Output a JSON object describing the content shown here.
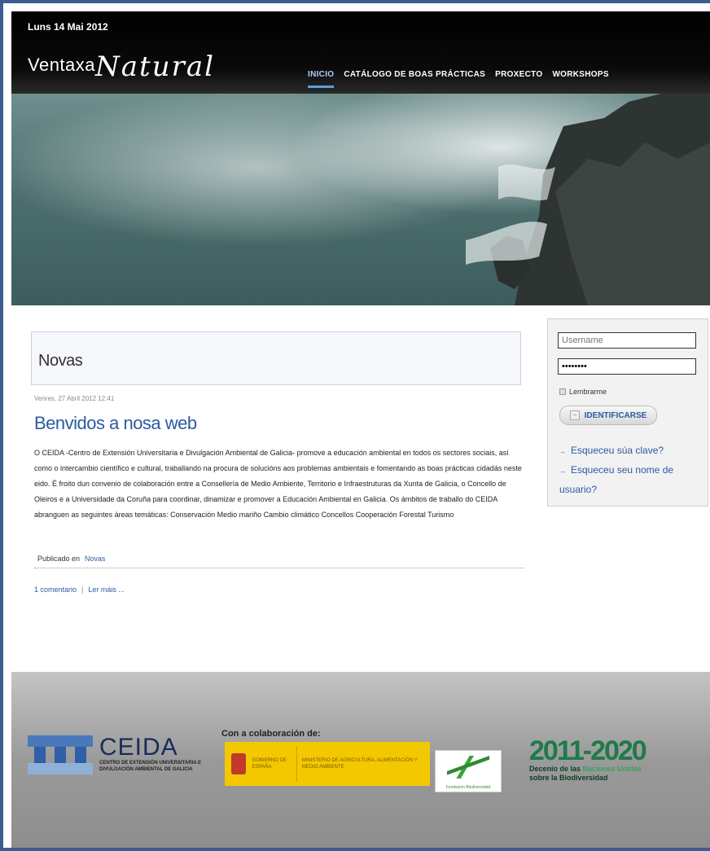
{
  "header": {
    "date": "Luns 14 Mai 2012",
    "logo_part1": "Ventaxa",
    "logo_part2": "Natural",
    "nav": [
      {
        "label": "INICIO",
        "active": true
      },
      {
        "label": "CATÁLOGO DE BOAS PRÁCTICAS",
        "active": false
      },
      {
        "label": "PROXECTO",
        "active": false
      },
      {
        "label": "WORKSHOPS",
        "active": false
      }
    ]
  },
  "main": {
    "section_title": "Novas",
    "post": {
      "meta": "Venres, 27 Abril 2012 12:41",
      "title": "Benvidos a nosa web",
      "body": "O CEIDA -Centro de Extensión Universitaria e Divulgación Ambiental de Galicia- promove a educación ambiental en todos os sectores sociais, así como o intercambio científico e cultural, traballando na procura de solucións aos problemas ambientais e fomentando as boas prácticas cidadás neste eido. É froito dun convenio de colaboración entre a Consellería de Medio Ambiente, Territorio e Infraestruturas da Xunta de Galicia, o Concello de Oleiros e a Universidade da Coruña para coordinar, dinamizar e promover a Educación Ambiental en Galicia. Os ámbitos de traballo do CEIDA abranguen as seguintes áreas temáticas: Conservación Medio mariño Cambio climático Concellos Cooperación Forestal Turismo",
      "published_label": "Publicado en",
      "published_category": "Novas",
      "comments_link": "1 comentario",
      "separator": "|",
      "read_more": "Ler máis ..."
    }
  },
  "login": {
    "username_placeholder": "Username",
    "password_value": "••••••••",
    "remember_label": "Lembrarme",
    "submit_label": "IDENTIFICARSE",
    "forgot_password": "Esqueceu súa clave?",
    "forgot_username": "Esqueceu seu nome de usuario?"
  },
  "footer": {
    "ceida_name": "CEIDA",
    "ceida_subtitle": "CENTRO DE EXTENSIÓN UNIVERSITARIA E DIVULGACIÓN AMBIENTAL DE GALICIA",
    "collab_label": "Con a colaboración de:",
    "gob_text": "GOBIERNO DE ESPAÑA",
    "ministry_text": "MINISTERIO DE AGRICULTURA, ALIMENTACIÓN Y MEDIO AMBIENTE",
    "fundacion_text": "Fundación Biodiversidad",
    "decade_years": "2011-2020",
    "decade_line1a": "Decenio de las ",
    "decade_line1b": "Naciones Unidas",
    "decade_line2": "sobre la Biodiversidad"
  },
  "colors": {
    "link_blue": "#2c5aa0",
    "frame_blue": "#3b5e8f",
    "nav_active": "#a9d0f5"
  }
}
